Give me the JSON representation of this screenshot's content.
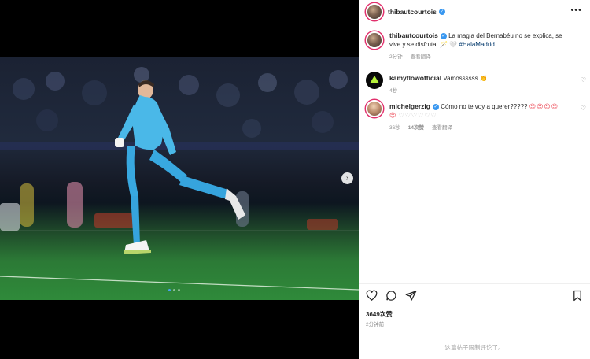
{
  "post": {
    "author": "thibautcourtois",
    "caption_username": "thibautcourtois",
    "caption_text": "La magia del Bernabéu no se explica, se vive y se disfruta. 🪄 🤍",
    "caption_hashtag": "#HalaMadrid",
    "caption_time": "2分钟",
    "caption_translate": "查看翻译",
    "likes": "3649次赞",
    "time_ago": "2分钟前",
    "comments_disabled": "这篇帖子限制评论了。",
    "more_label": "•••"
  },
  "comments": [
    {
      "username": "kamyflowofficial",
      "text": "Vamossssss 👏",
      "time": "4秒"
    },
    {
      "username": "michelgerzig",
      "text": "Cómo no te voy a querer?????",
      "emojis": "😍😍😍😍😍",
      "hearts": "♡♡♡♡♡♡",
      "time": "36秒",
      "likes": "14次赞",
      "translate": "查看翻译"
    }
  ],
  "carousel": {
    "slide_count": 3,
    "active_index": 0
  },
  "icons": [
    "more-options-icon",
    "verified-icon",
    "heart-icon",
    "comment-icon",
    "share-icon",
    "bookmark-icon",
    "next-arrow-icon"
  ],
  "colors": {
    "verified": "#3897f0",
    "hashtag": "#00376b",
    "muted": "#8e8e8e",
    "border": "#efefef"
  }
}
